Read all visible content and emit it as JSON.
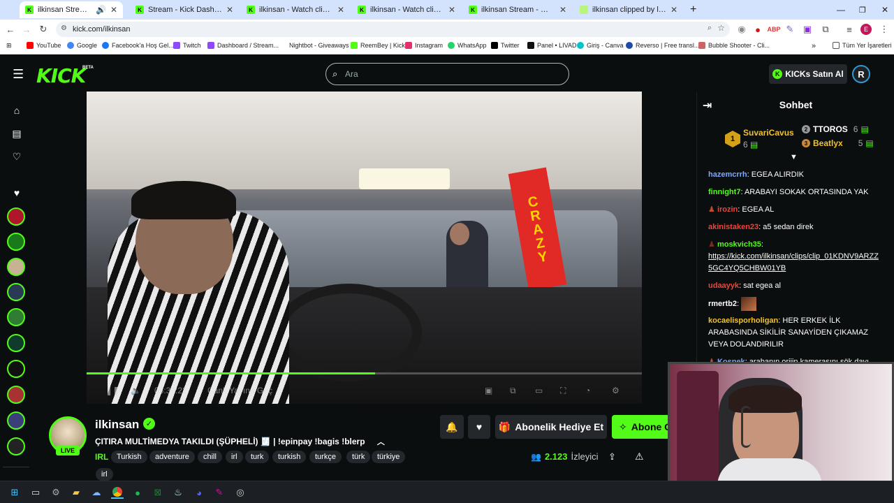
{
  "browser": {
    "tabs": [
      {
        "title": "ilkinsan Stream - Watch Live",
        "active": true
      },
      {
        "title": "Stream - Kick Dashboard",
        "active": false
      },
      {
        "title": "ilkinsan - Watch clips on Kick",
        "active": false
      },
      {
        "title": "ilkinsan - Watch clips on Kick",
        "active": false
      },
      {
        "title": "ilkinsan Stream - Watch Live on",
        "active": false
      },
      {
        "title": "ilkinsan clipped by leclercurry",
        "active": false
      }
    ],
    "url": "kick.com/ilkinsan",
    "profile_letter": "E",
    "bookmarks": [
      "YouTube",
      "Google",
      "Facebook'a Hoş Gel...",
      "Twitch",
      "Dashboard / Stream...",
      "Nightbot - Giveaways",
      "ReemBey | Kick",
      "Instagram",
      "WhatsApp",
      "Twitter",
      "Panel • LIVAD",
      "Giriş - Canva",
      "Reverso | Free transl...",
      "Bubble Shooter - Cli..."
    ],
    "all_bookmarks": "Tüm Yer İşaretleri"
  },
  "kick": {
    "logo": "KICK",
    "beta": "BETA",
    "search_placeholder": "Ara",
    "buy_kicks": "KICKs Satın Al",
    "profile_initial": "R"
  },
  "player": {
    "time": "05:39:22",
    "go_live": "Canlı Yayına Geç",
    "progress": 0.52,
    "sign_text": "CRAZY"
  },
  "channel": {
    "name": "ilkinsan",
    "live_badge": "LIVE",
    "title": "ÇITIRA MULTİMEDYA TAKILDI (ŞÜPHELİ) 🧾 | !epinpay !bagis !blerp",
    "category": "IRL",
    "tags": [
      "Turkish",
      "adventure",
      "chill",
      "irl",
      "turk",
      "turkish",
      "turkçe",
      "türk",
      "türkiye",
      "irl"
    ],
    "gift_sub": "Abonelik Hediye Et",
    "subscribe": "Abone O",
    "viewer_count": "2.123",
    "viewer_label": "İzleyici"
  },
  "chat": {
    "title": "Sohbet",
    "leaderboard": [
      {
        "rank": "1",
        "name": "SuvariCavus",
        "count": "6"
      },
      {
        "rank": "2",
        "name": "TTOROS",
        "count": "6"
      },
      {
        "rank": "3",
        "name": "Beatlyx",
        "count": "5"
      }
    ],
    "messages": [
      {
        "user": "hazemcrrh",
        "color": "#7ca9ff",
        "text": "EGEA ALIRDIK"
      },
      {
        "user": "finnight7",
        "color": "#53fc18",
        "text": "ARABAYI SOKAK ORTASINDA YAK"
      },
      {
        "user": "irozin",
        "color": "#e8473d",
        "text": "EGEA AL"
      },
      {
        "user": "akinistaken23",
        "color": "#e8473d",
        "text": "a5 sedan direk"
      },
      {
        "user": "moskvich35",
        "color": "#53fc18",
        "text": "https://kick.com/ilkinsan/clips/clip_01KDNV9ARZZ5GC4YQ5CHBW01YB"
      },
      {
        "user": "udaayyk",
        "color": "#e8473d",
        "text": "sat egea al"
      },
      {
        "user": "rmertb2",
        "color": "#ffffff",
        "text": ""
      },
      {
        "user": "kocaelisporholigan",
        "color": "#f2c12e",
        "text": "HER ERKEK İLK ARABASINDA SİKİLİR SANAYİDEN ÇIKAMAZ VEYA DOLANDIRILIR"
      },
      {
        "user": "Kosnek",
        "color": "#7ca9ff",
        "text": "arabanın orijin kamerasını sök dayı"
      }
    ]
  },
  "colors": {
    "kick_green": "#53fc18",
    "bg": "#0b0e0f",
    "button_gray": "#24272c"
  }
}
